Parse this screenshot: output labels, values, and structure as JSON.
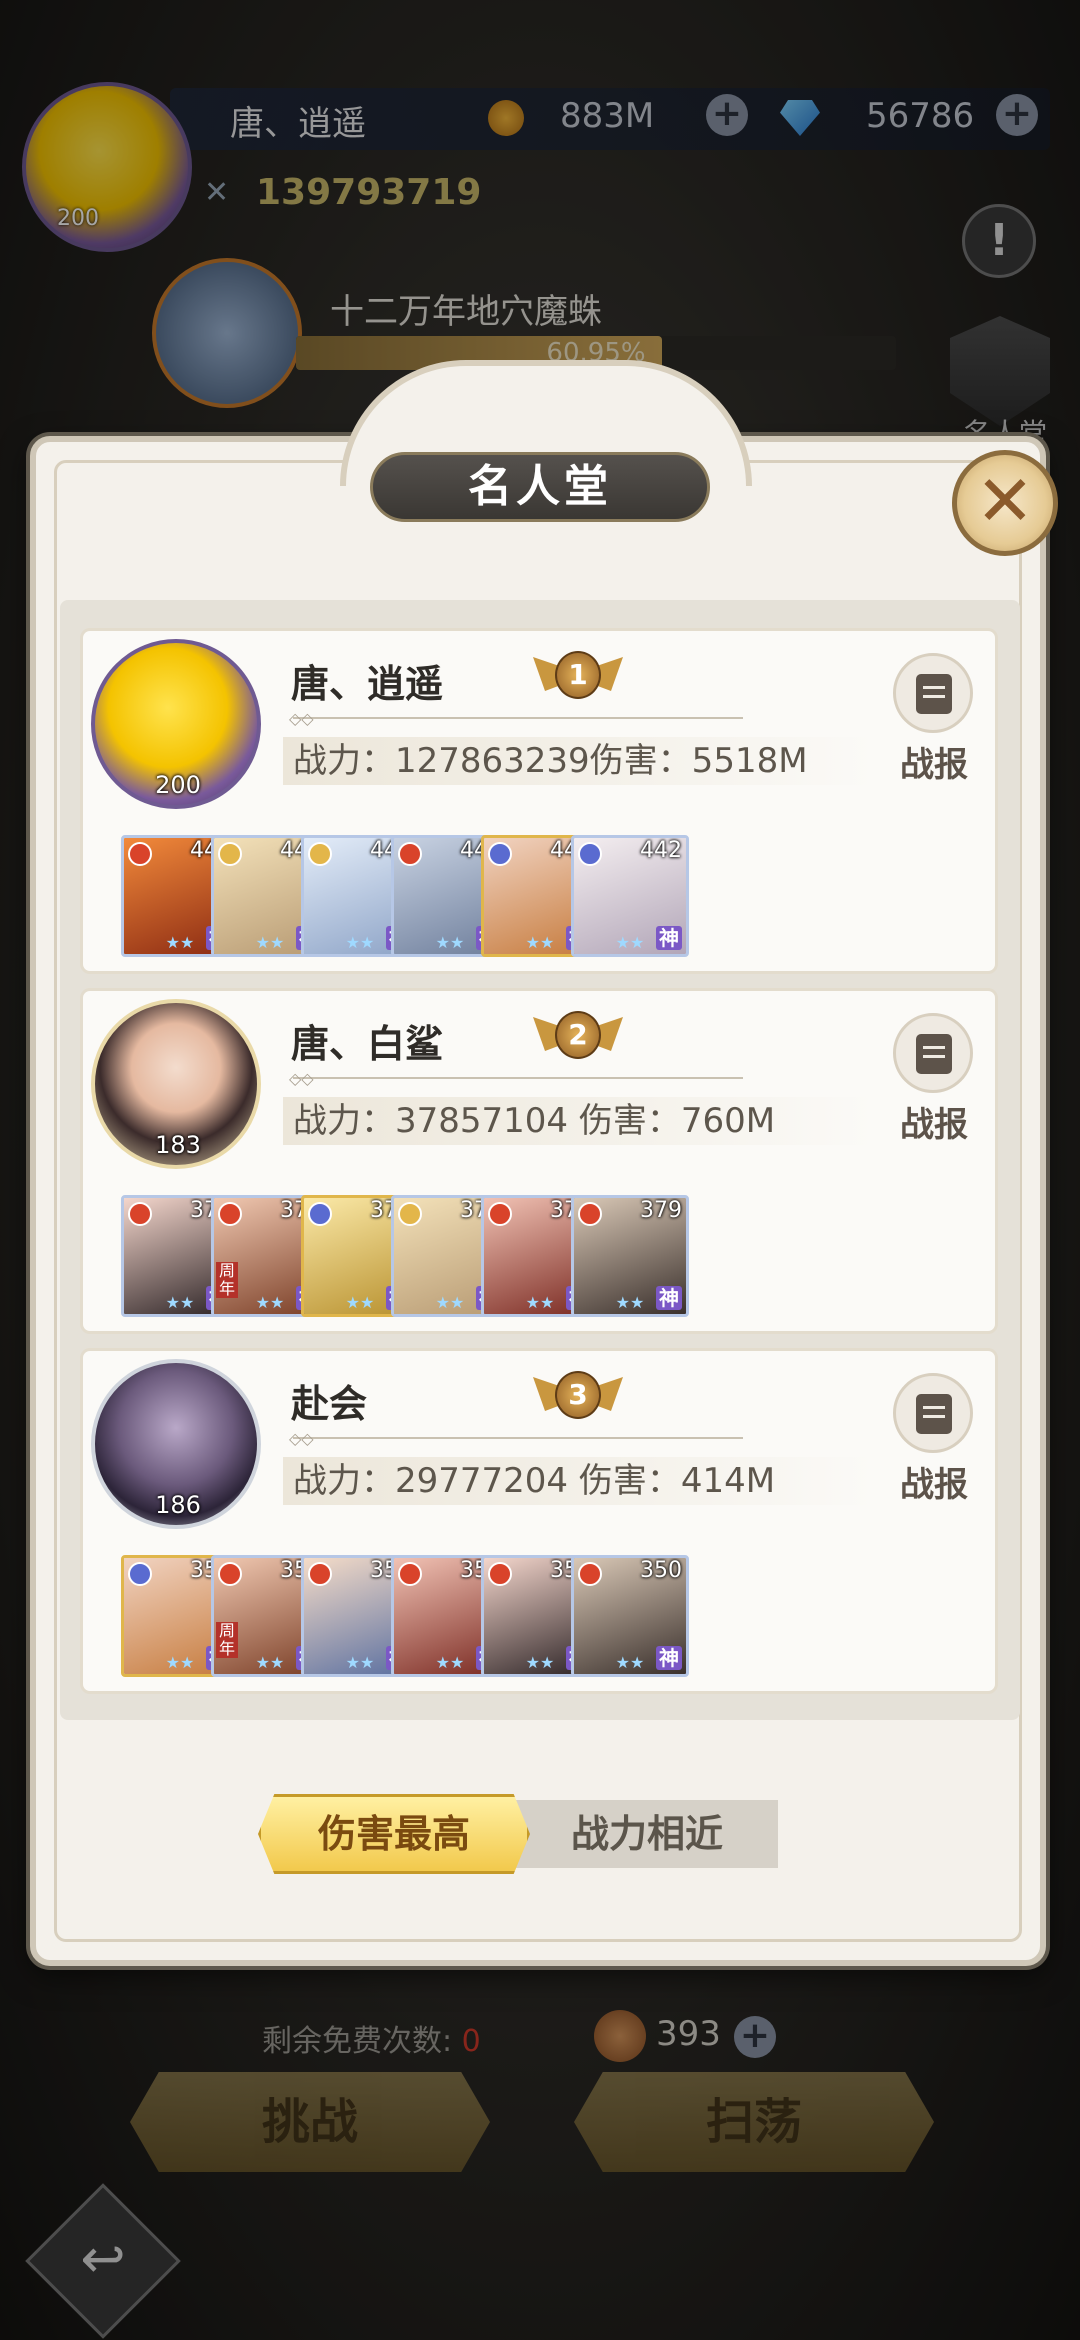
{
  "hud": {
    "player_name": "唐、逍遥",
    "player_level": "200",
    "gold": "883M",
    "gems": "56786",
    "power": "139793719"
  },
  "boss": {
    "name": "十二万年地穴魔蛛",
    "progress_label": "60.95%",
    "progress": 0.6095
  },
  "side_menu": {
    "hall_label": "名人堂"
  },
  "popup": {
    "title": "名人堂",
    "report_label": "战报",
    "entries": [
      {
        "rank": "1",
        "name": "唐、逍遥",
        "level": "200",
        "stats": "战力：127863239伤害：5518M",
        "heroes": [
          {
            "level": "442",
            "element": "fire",
            "style": "dragon"
          },
          {
            "level": "442",
            "element": "light",
            "style": "blonde"
          },
          {
            "level": "442",
            "element": "light",
            "style": "icy"
          },
          {
            "level": "442",
            "element": "fire",
            "style": "silver"
          },
          {
            "level": "442",
            "element": "dark",
            "style": "orange"
          },
          {
            "level": "442",
            "element": "dark",
            "style": "white"
          }
        ]
      },
      {
        "rank": "2",
        "name": "唐、白鲨",
        "level": "183",
        "stats": "战力：37857104 伤害：760M",
        "heroes": [
          {
            "level": "379",
            "element": "fire",
            "style": "black"
          },
          {
            "level": "379",
            "element": "fire",
            "style": "brown",
            "tag": "周年"
          },
          {
            "level": "379",
            "element": "dark",
            "style": "gold"
          },
          {
            "level": "379",
            "element": "light",
            "style": "blonde"
          },
          {
            "level": "379",
            "element": "fire",
            "style": "red"
          },
          {
            "level": "379",
            "element": "fire",
            "style": "dark"
          }
        ]
      },
      {
        "rank": "3",
        "name": "赴会",
        "level": "186",
        "stats": "战力：29777204 伤害：414M",
        "heroes": [
          {
            "level": "350",
            "element": "dark",
            "style": "orange"
          },
          {
            "level": "350",
            "element": "fire",
            "style": "brown",
            "tag": "周年"
          },
          {
            "level": "350",
            "element": "fire",
            "style": "boy"
          },
          {
            "level": "350",
            "element": "fire",
            "style": "red"
          },
          {
            "level": "350",
            "element": "fire",
            "style": "black"
          },
          {
            "level": "350",
            "element": "fire",
            "style": "dark"
          }
        ]
      }
    ],
    "tabs": {
      "damage": "伤害最高",
      "power": "战力相近"
    }
  },
  "bottom": {
    "free_times_label": "剩余免费次数:",
    "free_times_value": "0",
    "tickets": "393",
    "challenge": "挑战",
    "sweep": "扫荡"
  },
  "colors": {
    "gold_accent": "#f2c94c",
    "dark_pill": "#3a3733",
    "god_badge": "#7b58c6"
  }
}
